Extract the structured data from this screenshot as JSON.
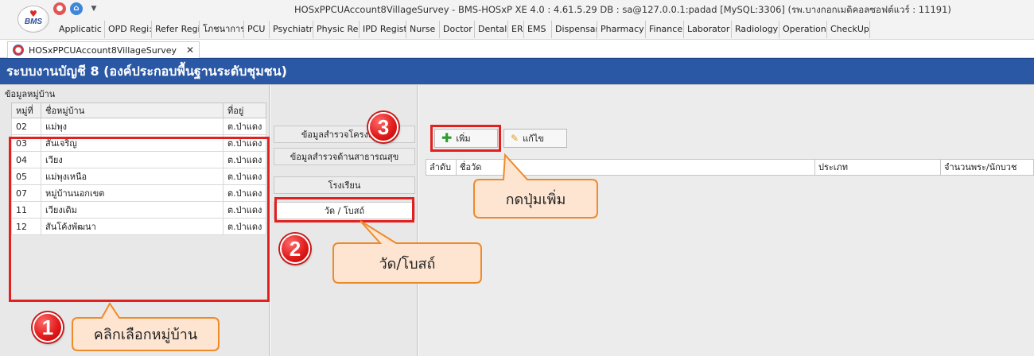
{
  "window": {
    "title": "HOSxPPCUAccount8VillageSurvey - BMS-HOSxP XE 4.0 : 4.61.5.29 DB : sa@127.0.0.1:padad [MySQL:3306] (รพ.บางกอกเมดิคอลซอฟต์แวร์ : 11191)",
    "logo_text": "BMS"
  },
  "menu": [
    "Applicatic",
    "OPD Regi:",
    "Refer Regi",
    "โภชนาการ",
    "PCU",
    "Psychiatri",
    "Physic Re:",
    "IPD Regist",
    "Nurse",
    "Doctor",
    "Dental",
    "ER",
    "EMS",
    "Dispensar",
    "Pharmacy",
    "Finance",
    "Laborator",
    "Radiology",
    "Operation",
    "CheckUp"
  ],
  "doc_tab": {
    "label": "HOSxPPCUAccount8VillageSurvey",
    "close": "✕"
  },
  "header": {
    "title": "ระบบงานบัญชี 8 (องค์ประกอบพื้นฐานระดับชุมชน)"
  },
  "left_panel": {
    "title": "ข้อมูลหมู่บ้าน",
    "columns": [
      "หมู่ที่",
      "ชื่อหมู่บ้าน",
      "ที่อยู่"
    ],
    "rows": [
      {
        "no": "02",
        "name": "แม่พุง",
        "addr": "ต.ป่าแดง"
      },
      {
        "no": "03",
        "name": "สันเจริญ",
        "addr": "ต.ป่าแดง"
      },
      {
        "no": "04",
        "name": "เวียง",
        "addr": "ต.ป่าแดง"
      },
      {
        "no": "05",
        "name": "แม่พุงเหนือ",
        "addr": "ต.ป่าแดง"
      },
      {
        "no": "07",
        "name": "หมู่บ้านนอกเขต",
        "addr": "ต.ป่าแดง"
      },
      {
        "no": "11",
        "name": "เวียงเดิม",
        "addr": "ต.ป่าแดง"
      },
      {
        "no": "12",
        "name": "สันโค้งพัฒนา",
        "addr": "ต.ป่าแดง"
      }
    ]
  },
  "middle_tabs": [
    "ข้อมูลสำรวจโครงสร้าง",
    "ข้อมูลสำรวจด้านสาธารณสุข",
    "โรงเรียน",
    "วัด / โบสถ์"
  ],
  "toolbar": {
    "add": "เพิ่ม",
    "edit": "แก้ไข"
  },
  "grid": {
    "columns": [
      "ลำดับ",
      "ชื่อวัด",
      "ประเภท",
      "จำนวนพระ/นักบวช"
    ]
  },
  "annotations": {
    "badge1": "1",
    "badge2": "2",
    "badge3": "3",
    "callout1": "คลิกเลือกหมู่บ้าน",
    "callout2": "วัด/โบสถ์",
    "callout3": "กดปุ่มเพิ่ม",
    "highlight_color": "#e22020",
    "callout_fill": "#fde5d2",
    "callout_stroke": "#ef8a2a"
  }
}
